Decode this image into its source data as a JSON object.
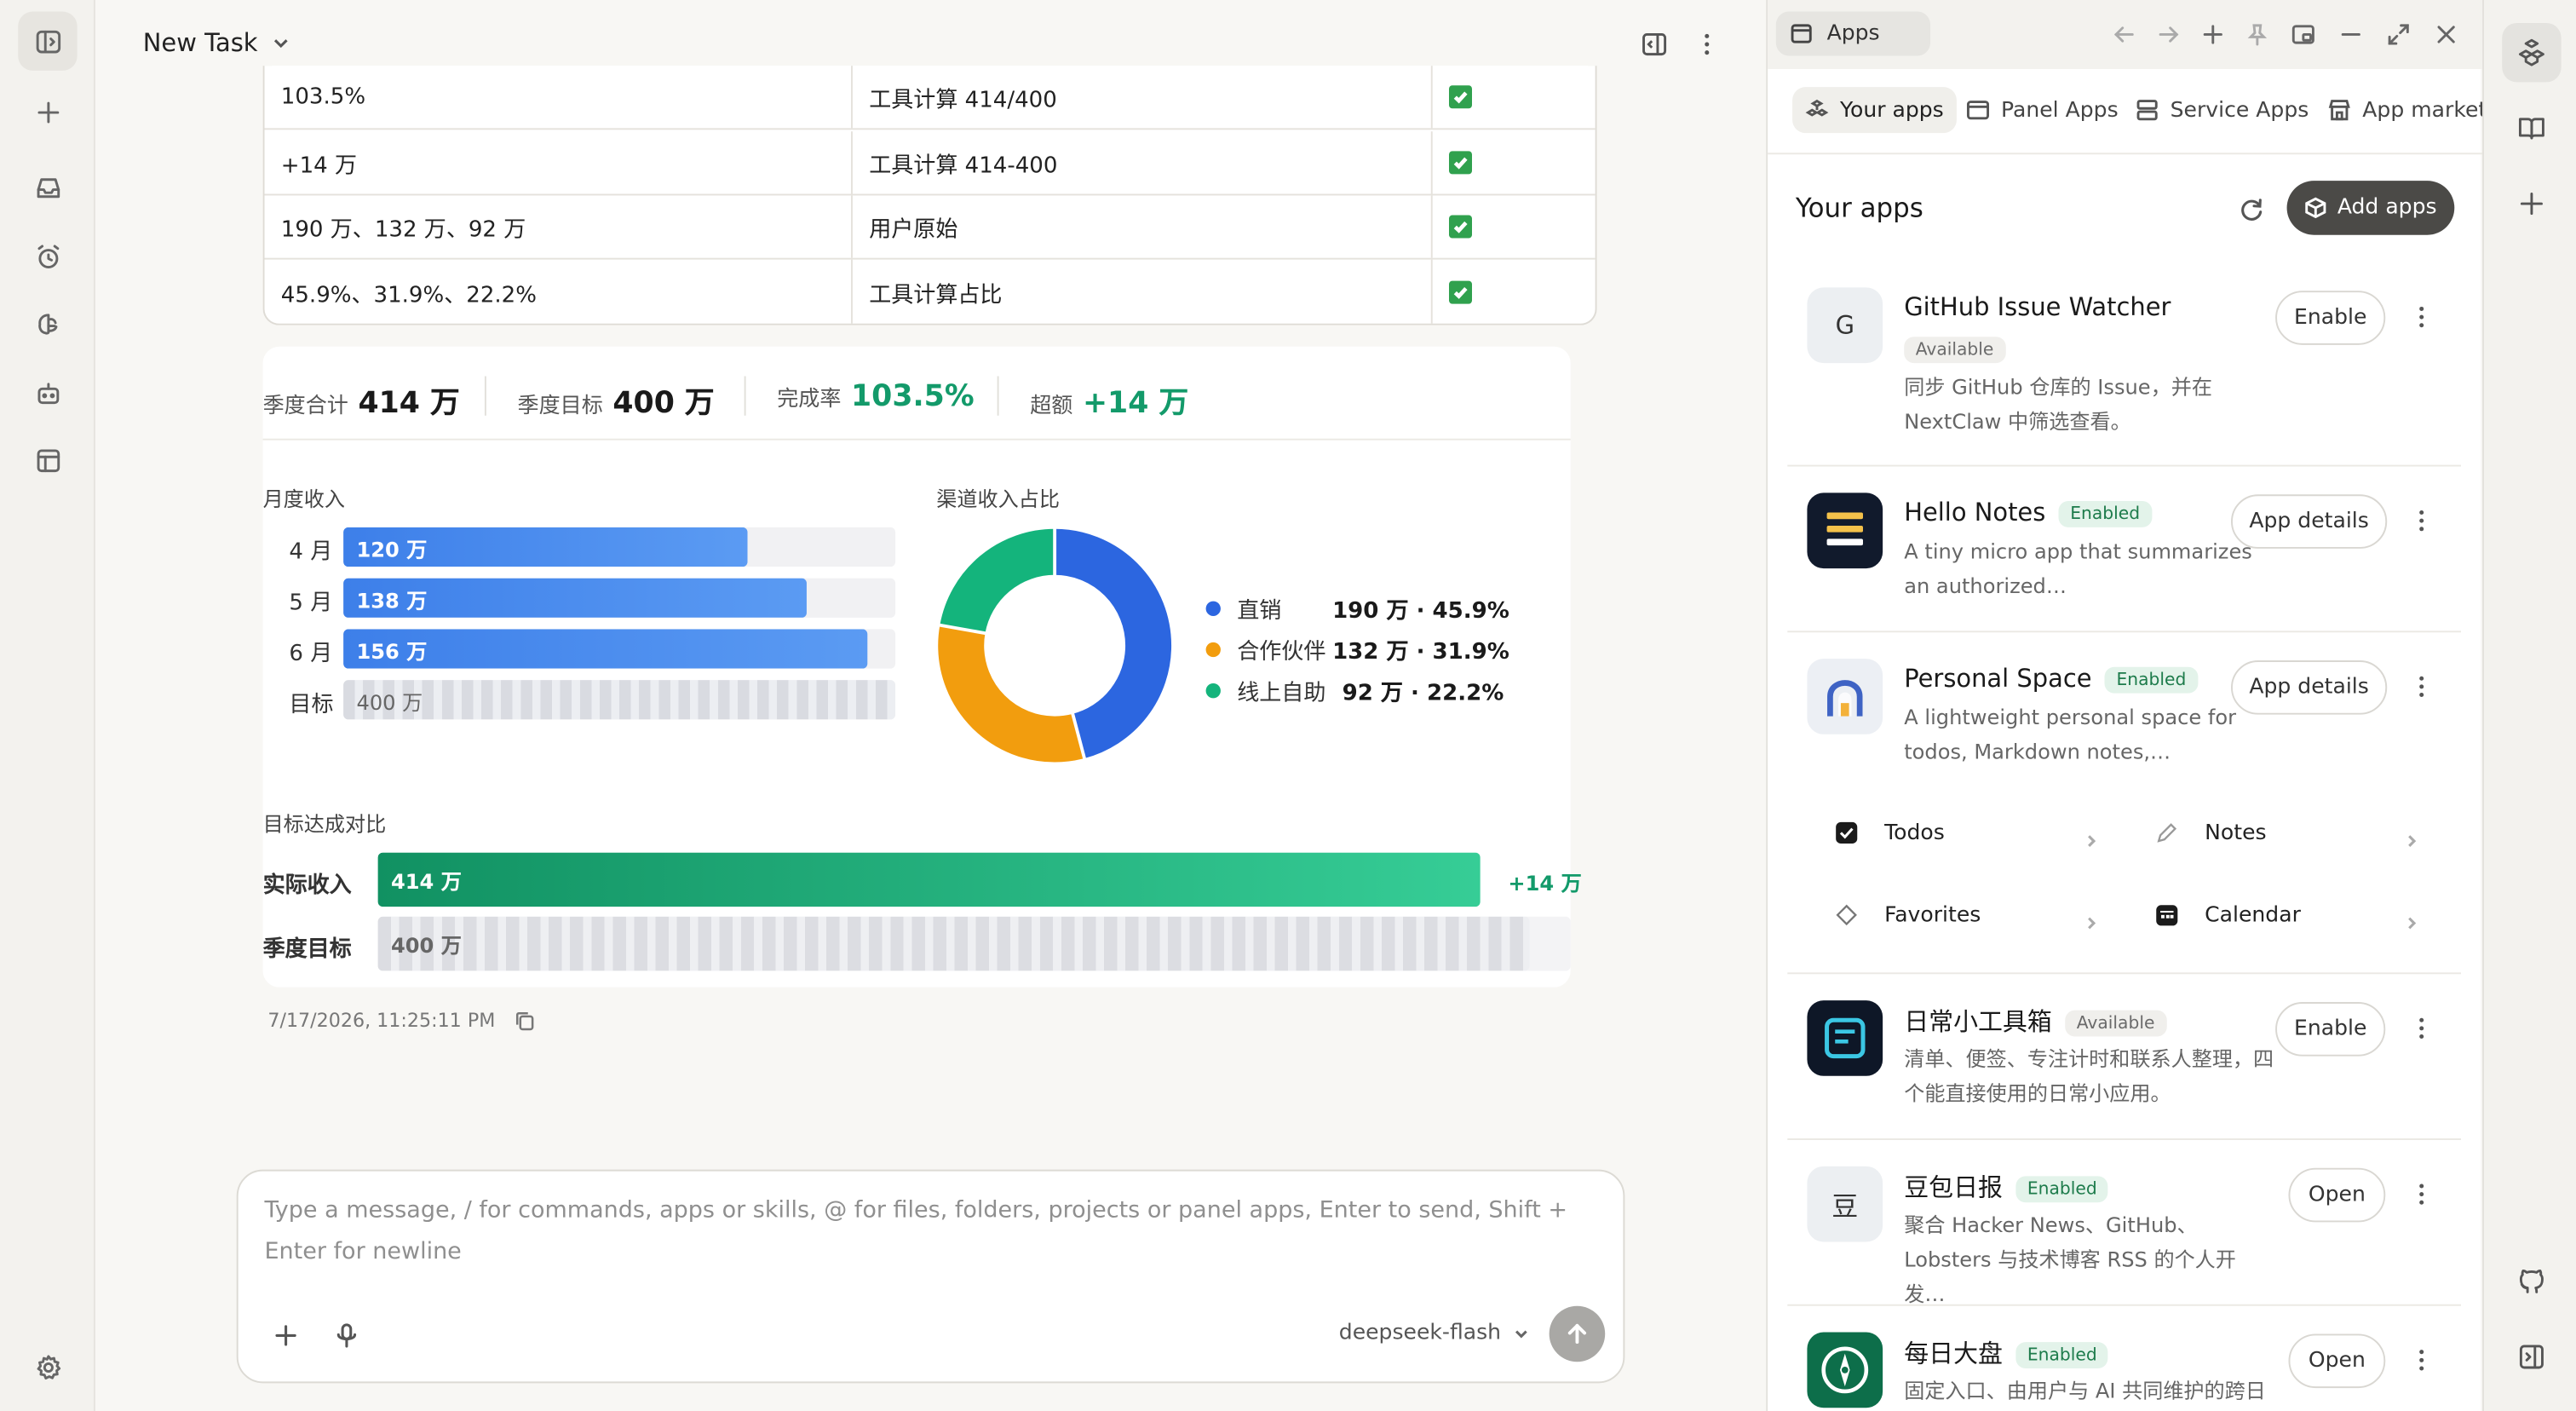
{
  "window": {
    "task_title": "New Task"
  },
  "table": {
    "rows": [
      {
        "value": "103.5%",
        "source": "工具计算 414/400"
      },
      {
        "value": "+14 万",
        "source": "工具计算 414-400"
      },
      {
        "value": "190 万、132 万、92 万",
        "source": "用户原始"
      },
      {
        "value": "45.9%、31.9%、22.2%",
        "source": "工具计算占比"
      }
    ]
  },
  "dashboard": {
    "kpis": [
      {
        "label": "季度合计",
        "value": "414 万"
      },
      {
        "label": "季度目标",
        "value": "400 万"
      },
      {
        "label": "完成率",
        "value": "103.5%"
      },
      {
        "label": "超额",
        "value": "+14 万"
      }
    ],
    "monthly_title": "月度收入",
    "monthly": [
      {
        "label": "4 月",
        "value_text": "120 万",
        "fraction": 0.731
      },
      {
        "label": "5 月",
        "value_text": "138 万",
        "fraction": 0.839
      },
      {
        "label": "6 月",
        "value_text": "156 万",
        "fraction": 0.949
      },
      {
        "label": "目标",
        "value_text": "400 万",
        "fraction": 1.0
      }
    ],
    "channel_title": "渠道收入占比",
    "channels": [
      {
        "name": "直销",
        "value_text": "190 万 · 45.9%",
        "percent": 45.9,
        "color": "#2c66e0"
      },
      {
        "name": "合作伙伴",
        "value_text": "132 万 · 31.9%",
        "percent": 31.9,
        "color": "#f29d0e"
      },
      {
        "name": "线上自助",
        "value_text": "92 万 · 22.2%",
        "percent": 22.2,
        "color": "#14b47c"
      }
    ],
    "compare_title": "目标达成对比",
    "compare": {
      "actual_label": "实际收入",
      "actual_value": "414 万",
      "actual_fraction": 0.924,
      "overflow": "+14 万",
      "target_label": "季度目标",
      "target_value": "400 万",
      "target_fraction": 0.966
    }
  },
  "message": {
    "timestamp": "7/17/2026, 11:25:11 PM"
  },
  "composer": {
    "placeholder": "Type a message, / for commands, apps or skills, @ for files, folders, projects or panel apps, Enter to send, Shift + Enter for newline",
    "model": "deepseek-flash"
  },
  "panel": {
    "tab_label": "Apps",
    "segments": [
      "Your apps",
      "Panel Apps",
      "Service Apps",
      "App marketp"
    ],
    "heading": "Your apps",
    "add_button": "Add apps",
    "apps": [
      {
        "name": "GitHub Issue Watcher",
        "status": "Available",
        "desc": "同步 GitHub 仓库的 Issue，并在 NextClaw 中筛选查看。",
        "action": "Enable",
        "icon_letter": "G"
      },
      {
        "name": "Hello Notes",
        "status": "Enabled",
        "desc": "A tiny micro app that summarizes an authorized…",
        "action": "App details"
      },
      {
        "name": "Personal Space",
        "status": "Enabled",
        "desc": "A lightweight personal space for todos, Markdown notes,…",
        "action": "App details"
      },
      {
        "name": "日常小工具箱",
        "status": "Available",
        "desc": "清单、便签、专注计时和联系人整理，四个能直接使用的日常小应用。",
        "action": "Enable"
      },
      {
        "name": "豆包日报",
        "status": "Enabled",
        "desc": "聚合 Hacker News、GitHub、Lobsters 与技术博客 RSS 的个人开发…",
        "action": "Open",
        "icon_letter": "豆"
      },
      {
        "name": "每日大盘",
        "status": "Enabled",
        "desc": "固定入口、由用户与 AI 共同维护的跨日",
        "action": "Open"
      }
    ],
    "subitems": [
      "Todos",
      "Notes",
      "Favorites",
      "Calendar"
    ]
  }
}
